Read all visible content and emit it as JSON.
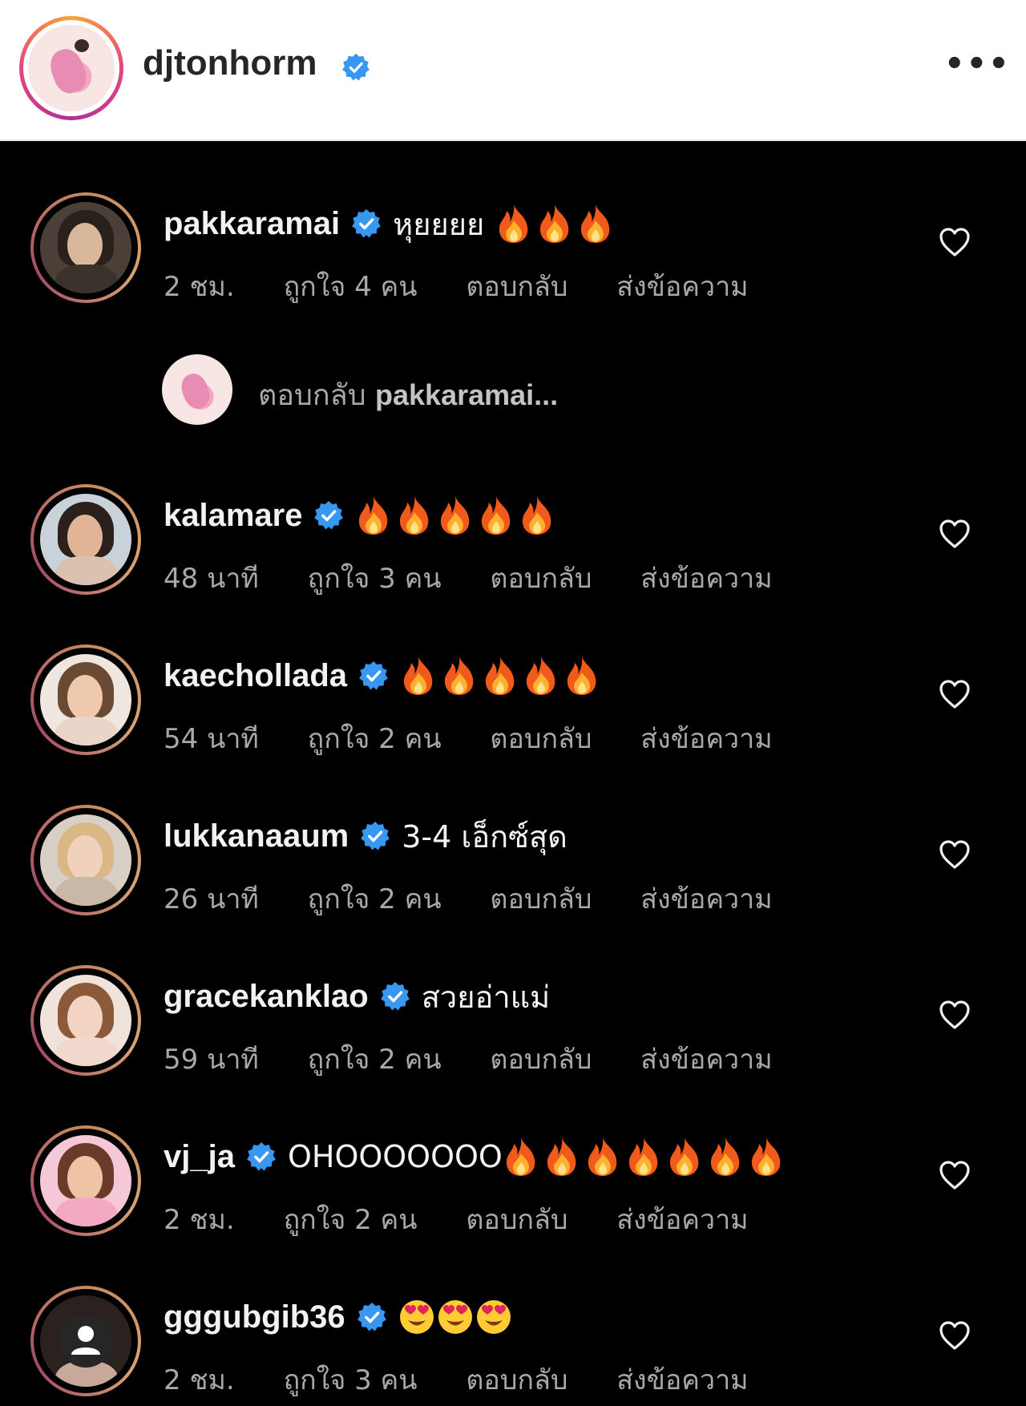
{
  "header": {
    "username": "djtonhorm",
    "verified": true
  },
  "reply_prompt": {
    "label": "ตอบกลับ",
    "target": "pakkaramai..."
  },
  "actions": {
    "reply": "ตอบกลับ",
    "message": "ส่งข้อความ"
  },
  "colors": {
    "background": "#000000",
    "header_bg": "#ffffff",
    "verified_blue": "#3897f0",
    "secondary_text": "#a8a8a8"
  },
  "comments": [
    {
      "username": "pakkaramai",
      "text": "หุยยยย",
      "emoji": "fire",
      "emoji_count": 3,
      "time": "2 ชม.",
      "likes": "ถูกใจ 4 คน"
    },
    {
      "username": "kalamare",
      "text": "",
      "emoji": "fire",
      "emoji_count": 5,
      "time": "48 นาที",
      "likes": "ถูกใจ 3 คน"
    },
    {
      "username": "kaechollada",
      "text": "",
      "emoji": "fire",
      "emoji_count": 5,
      "time": "54 นาที",
      "likes": "ถูกใจ 2 คน"
    },
    {
      "username": "lukkanaaum",
      "text": "3-4 เอ็กซ์สุด",
      "emoji": "",
      "emoji_count": 0,
      "time": "26 นาที",
      "likes": "ถูกใจ 2 คน"
    },
    {
      "username": "gracekanklao",
      "text": "สวยอ่าแม่",
      "emoji": "",
      "emoji_count": 0,
      "time": "59 นาที",
      "likes": "ถูกใจ 2 คน"
    },
    {
      "username": "vj_ja",
      "text": "OHOOOOOOO",
      "emoji": "fire",
      "emoji_count": 7,
      "time": "2 ชม.",
      "likes": "ถูกใจ 2 คน"
    },
    {
      "username": "gggubgib36",
      "text": "",
      "emoji": "heart-eyes",
      "emoji_count": 3,
      "time": "2 ชม.",
      "likes": "ถูกใจ 3 คน"
    }
  ]
}
